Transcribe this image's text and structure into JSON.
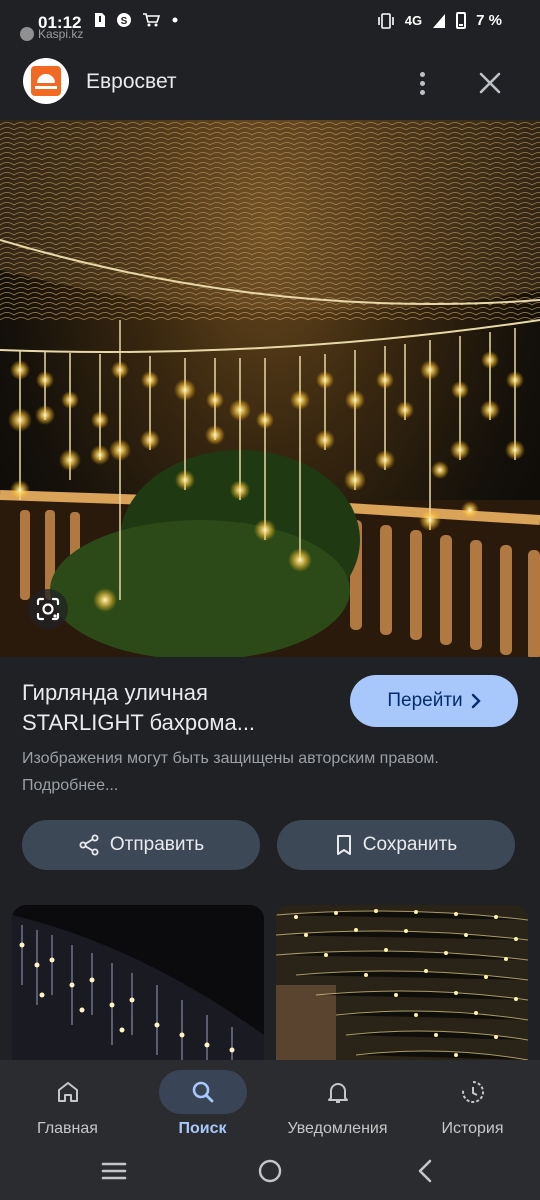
{
  "status_bar": {
    "time": "01:12",
    "network": "4G",
    "battery": "7 %",
    "watermark": "Kaspi.kz"
  },
  "header": {
    "site_name": "Евросвет",
    "logo_color": "#f26a21"
  },
  "result": {
    "title": "Гирлянда уличная STARLIGHT бахрома...",
    "visit_label": "Перейти",
    "notice": "Изображения могут быть защищены авторским правом. Подробнее..."
  },
  "actions": {
    "share_label": "Отправить",
    "save_label": "Сохранить"
  },
  "bottom_nav": {
    "items": [
      {
        "label": "Главная",
        "icon": "home-icon"
      },
      {
        "label": "Поиск",
        "icon": "search-icon",
        "active": true
      },
      {
        "label": "Уведомления",
        "icon": "bell-icon"
      },
      {
        "label": "История",
        "icon": "history-icon"
      }
    ]
  },
  "colors": {
    "background": "#202124",
    "accent": "#a8c7fa",
    "button": "#3c4856"
  }
}
